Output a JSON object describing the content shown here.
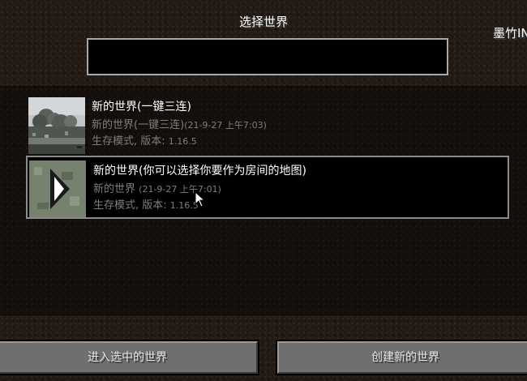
{
  "header": {
    "title": "选择世界",
    "corner_text": "墨竹IN",
    "search": {
      "value": "",
      "placeholder": ""
    }
  },
  "worlds": [
    {
      "name": "新的世界(一键三连)",
      "folder": "新的世界(一键三连)",
      "date": "(21-9-27 上午7:03)",
      "mode": "生存模式, 版本:",
      "version": "1.16.5",
      "selected": false,
      "thumbnail": "tree-landscape-thumbnail"
    },
    {
      "name": "新的世界(你可以选择你要作为房间的地图)",
      "folder": "新的世界",
      "date": "(21-9-27 上午7:01)",
      "mode": "生存模式, 版本:",
      "version": "1.16.5",
      "selected": true,
      "thumbnail": "play-arrow-thumbnail"
    }
  ],
  "buttons": {
    "play_selected": "进入选中的世界",
    "create_new": "创建新的世界"
  },
  "colors": {
    "selected_border": "#8b8b8b",
    "subtext": "#7e7e7e",
    "button_face": "#6f6f6f"
  }
}
